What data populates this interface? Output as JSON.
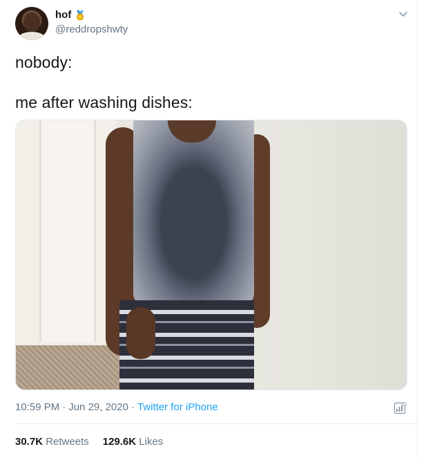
{
  "user": {
    "display_name": "hof",
    "handle": "@reddropshwty",
    "badge_icon": "medal-icon"
  },
  "tweet": {
    "line1": "nobody:",
    "line2": "me after washing dishes:"
  },
  "meta": {
    "time": "10:59 PM",
    "sep1": "·",
    "date": "Jun 29, 2020",
    "sep2": "·",
    "source": "Twitter for iPhone"
  },
  "stats": {
    "retweets_count": "30.7K",
    "retweets_label": "Retweets",
    "likes_count": "129.6K",
    "likes_label": "Likes"
  },
  "colors": {
    "link": "#1da1f2",
    "secondary_text": "#657786",
    "primary_text": "#14171a"
  }
}
